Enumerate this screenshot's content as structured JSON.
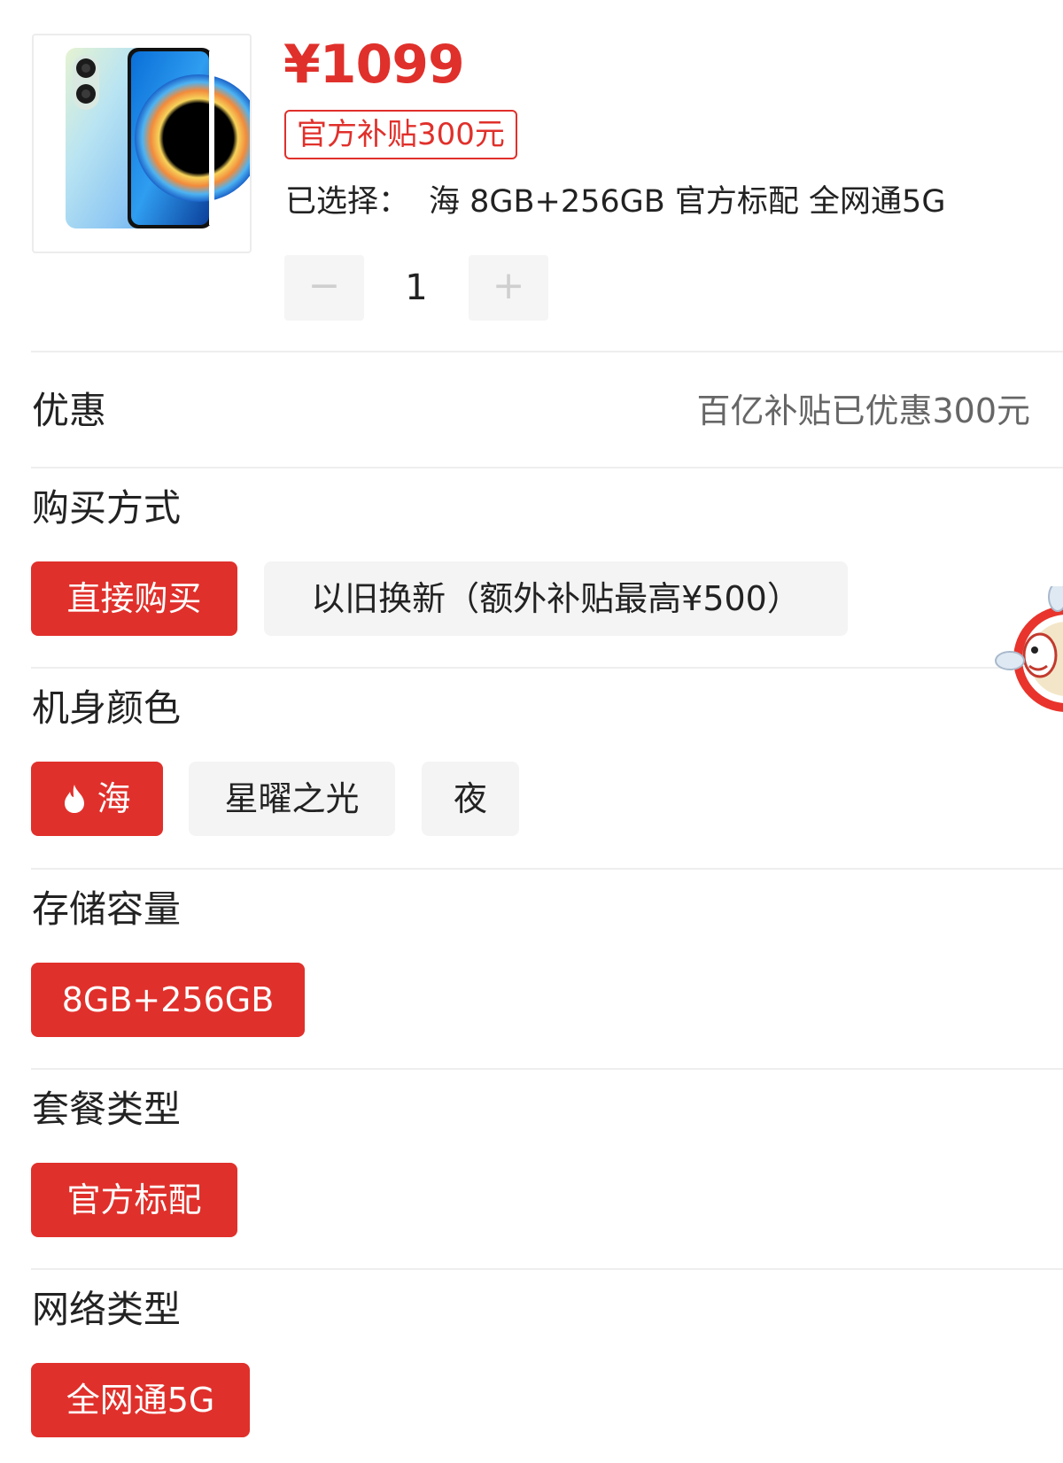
{
  "product": {
    "price": "¥1099",
    "subsidy_tag": "官方补贴300元",
    "selected_label": "已选择：",
    "selected_value": "海 8GB+256GB 官方标配 全网通5G",
    "image_icon": "phone-product-image",
    "quantity": "1",
    "minus_label": "−",
    "plus_label": "+"
  },
  "discount": {
    "title": "优惠",
    "value": "百亿补贴已优惠300元"
  },
  "purchase_method": {
    "title": "购买方式",
    "options": [
      {
        "label": "直接购买",
        "selected": true
      },
      {
        "label": "以旧换新（额外补贴最高¥500）",
        "selected": false
      }
    ]
  },
  "color": {
    "title": "机身颜色",
    "options": [
      {
        "label": "海",
        "selected": true,
        "icon": "flame-icon"
      },
      {
        "label": "星曜之光",
        "selected": false
      },
      {
        "label": "夜",
        "selected": false
      }
    ]
  },
  "storage": {
    "title": "存储容量",
    "options": [
      {
        "label": "8GB+256GB",
        "selected": true
      }
    ]
  },
  "package": {
    "title": "套餐类型",
    "options": [
      {
        "label": "官方标配",
        "selected": true
      }
    ]
  },
  "network": {
    "title": "网络类型",
    "options": [
      {
        "label": "全网通5G",
        "selected": true
      }
    ]
  },
  "colors": {
    "accent": "#e0302b",
    "option_bg": "#f4f4f4",
    "divider": "#eeeeee",
    "muted_text": "#666666"
  }
}
